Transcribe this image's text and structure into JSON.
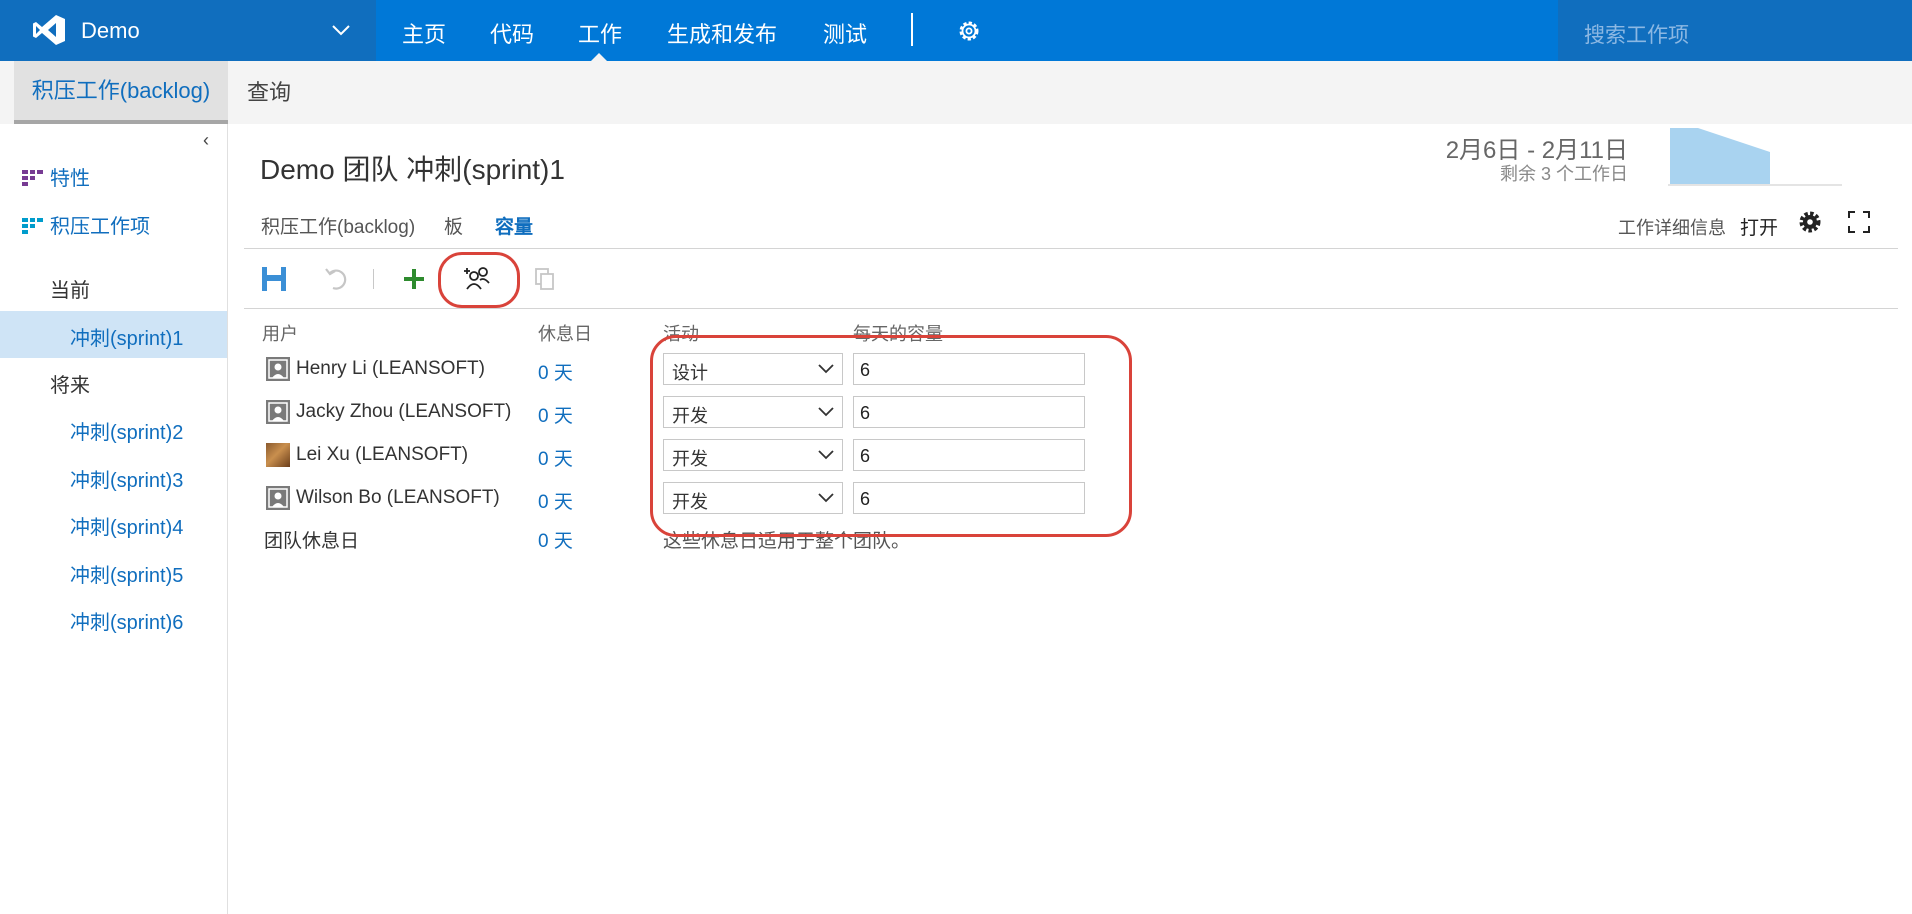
{
  "nav": {
    "project_name": "Demo",
    "items": [
      "主页",
      "代码",
      "工作",
      "生成和发布",
      "测试"
    ],
    "search_placeholder": "搜索工作项"
  },
  "hub": {
    "tabs": [
      "积压工作(backlog)",
      "查询"
    ]
  },
  "sidebar": {
    "links": [
      "特性",
      "积压工作项"
    ],
    "current_label": "当前",
    "current_sprint": "冲刺(sprint)1",
    "future_label": "将来",
    "future_sprints": [
      "冲刺(sprint)2",
      "冲刺(sprint)3",
      "冲刺(sprint)4",
      "冲刺(sprint)5",
      "冲刺(sprint)6"
    ]
  },
  "header": {
    "title": "Demo 团队 冲刺(sprint)1",
    "date_range": "2月6日 - 2月11日",
    "days_remaining": "剩余 3 个工作日"
  },
  "pivots": [
    "积压工作(backlog)",
    "板",
    "容量"
  ],
  "work_details": {
    "label": "工作详细信息",
    "state": "打开"
  },
  "capacity_table": {
    "columns": [
      "用户",
      "休息日",
      "活动",
      "每天的容量"
    ],
    "rows": [
      {
        "user": "Henry Li (LEANSOFT)",
        "days_off": "0 天",
        "activity": "设计",
        "capacity": "6"
      },
      {
        "user": "Jacky Zhou (LEANSOFT)",
        "days_off": "0 天",
        "activity": "开发",
        "capacity": "6"
      },
      {
        "user": "Lei Xu (LEANSOFT)",
        "days_off": "0 天",
        "activity": "开发",
        "capacity": "6"
      },
      {
        "user": "Wilson Bo (LEANSOFT)",
        "days_off": "0 天",
        "activity": "开发",
        "capacity": "6"
      }
    ],
    "team_days_off_label": "团队休息日",
    "team_days_off_value": "0 天",
    "team_days_off_note": "这些休息日适用于整个团队。"
  },
  "colors": {
    "nav_bg": "#0078d7",
    "accent": "#106ebe",
    "highlight": "#d9433a",
    "add_green": "#2e8b2e"
  }
}
